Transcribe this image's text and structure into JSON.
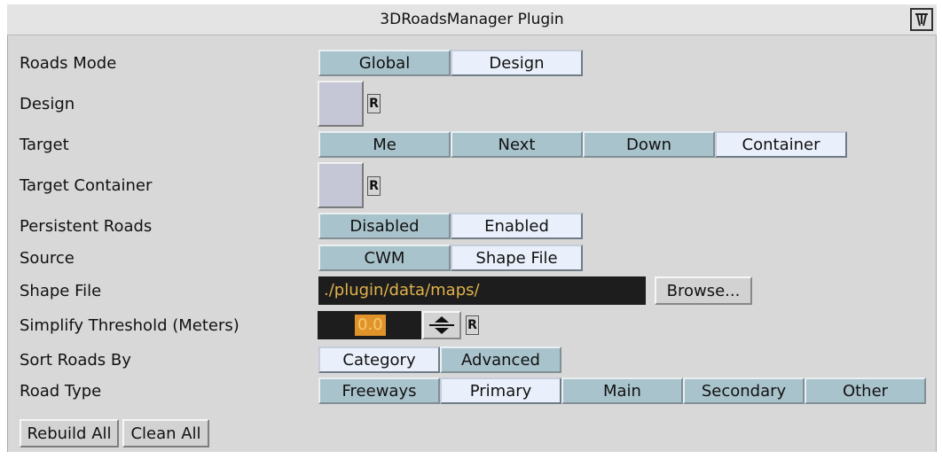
{
  "window": {
    "title": "3DRoadsManager Plugin"
  },
  "labels": {
    "roads_mode": "Roads Mode",
    "design": "Design",
    "target": "Target",
    "target_container": "Target Container",
    "persistent_roads": "Persistent Roads",
    "source": "Source",
    "shape_file": "Shape File",
    "simplify_threshold": "Simplify Threshold (Meters)",
    "sort_roads_by": "Sort Roads By",
    "road_type": "Road Type"
  },
  "roads_mode": {
    "options": [
      "Global",
      "Design"
    ],
    "selected": "Design"
  },
  "target": {
    "options": [
      "Me",
      "Next",
      "Down",
      "Container"
    ],
    "selected": "Container"
  },
  "persistent_roads": {
    "options": [
      "Disabled",
      "Enabled"
    ],
    "selected": "Enabled"
  },
  "source": {
    "options": [
      "CWM",
      "Shape File"
    ],
    "selected": "Shape File"
  },
  "shape_file": {
    "value": "./plugin/data/maps/",
    "browse_label": "Browse..."
  },
  "simplify_threshold": {
    "value": "0.0"
  },
  "sort_roads_by": {
    "options": [
      "Category",
      "Advanced"
    ],
    "selected": "Category"
  },
  "road_type": {
    "options": [
      "Freeways",
      "Primary",
      "Main",
      "Secondary",
      "Other"
    ],
    "selected": "Primary"
  },
  "reset_label": "R",
  "actions": {
    "rebuild_all": "Rebuild All",
    "clean_all": "Clean All"
  },
  "colors": {
    "panel_bg": "#d8d8d8",
    "button_off": "#a9c3cc",
    "button_on": "#eaf0fb",
    "field_bg": "#1d1d1d",
    "field_text": "#e1b24b",
    "number_highlight": "#e0932b"
  },
  "icons": {
    "corner": "plugin-window-icon",
    "stepper_up": "arrow-up-icon",
    "stepper_down": "arrow-down-icon"
  }
}
